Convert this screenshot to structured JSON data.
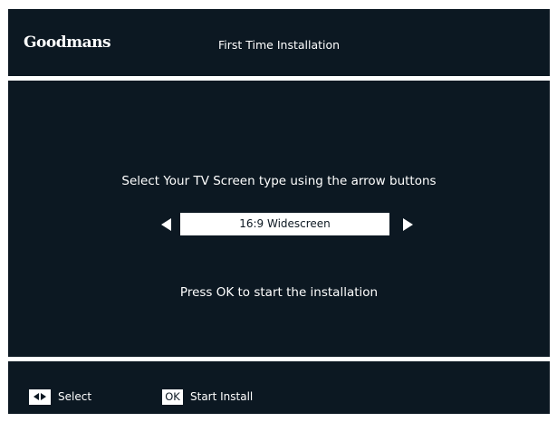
{
  "header": {
    "logo_text": "Goodmans",
    "title": "First Time Installation"
  },
  "main": {
    "instruction": "Select Your TV Screen type using the arrow buttons",
    "selector": {
      "value": "16:9 Widescreen",
      "left_icon": "left-arrow-icon",
      "right_icon": "right-arrow-icon"
    },
    "prompt": "Press OK to start the installation"
  },
  "footer": {
    "select_key_icon": "left-right-arrows-icon",
    "select_label": "Select",
    "ok_key_label": "OK",
    "install_label": "Start Install"
  },
  "colors": {
    "panel_background": "#0c1822",
    "text": "#ffffff",
    "page_background": "#ffffff"
  }
}
